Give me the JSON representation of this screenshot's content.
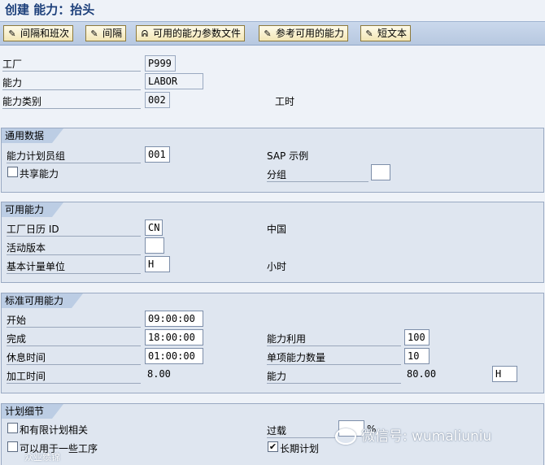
{
  "window": {
    "title": "创建 能力：抬头"
  },
  "toolbar": {
    "buttons": [
      {
        "label": "间隔和班次",
        "icon": "pencil-icon"
      },
      {
        "label": "间隔",
        "icon": "pencil-icon"
      },
      {
        "label": "可用的能力参数文件",
        "icon": "glasses-icon"
      },
      {
        "label": "参考可用的能力",
        "icon": "pencil-icon"
      },
      {
        "label": "短文本",
        "icon": "pencil-icon"
      }
    ]
  },
  "header": {
    "plant_label": "工厂",
    "plant_value": "P999",
    "capacity_label": "能力",
    "capacity_value": "LABOR",
    "capacity_category_label": "能力类别",
    "capacity_category_value": "002",
    "capacity_category_text": "工时"
  },
  "general_data": {
    "title": "通用数据",
    "planner_group_label": "能力计划员组",
    "planner_group_value": "001",
    "planner_group_text": "SAP 示例",
    "pooled_capacity_label": "共享能力",
    "pooled_capacity_checked": false,
    "grouping_label": "分组",
    "grouping_value": ""
  },
  "available_capacity": {
    "title": "可用能力",
    "factory_calendar_label": "工厂日历 ID",
    "factory_calendar_value": "CN",
    "factory_calendar_text": "中国",
    "active_version_label": "活动版本",
    "active_version_value": "",
    "base_unit_label": "基本计量单位",
    "base_unit_value": "H",
    "base_unit_text": "小时"
  },
  "standard_capacity": {
    "title": "标准可用能力",
    "start_label": "开始",
    "start_value": "09:00:00",
    "finish_label": "完成",
    "finish_value": "18:00:00",
    "break_label": "休息时间",
    "break_value": "01:00:00",
    "operating_time_label": "加工时间",
    "operating_time_value": "8.00",
    "utilization_label": "能力利用",
    "utilization_value": "100",
    "num_capacities_label": "单项能力数量",
    "num_capacities_value": "10",
    "capacity_label": "能力",
    "capacity_value": "80.00",
    "capacity_unit": "H"
  },
  "planning_details": {
    "title": "计划细节",
    "finite_scheduling_label": "和有限计划相关",
    "finite_scheduling_checked": false,
    "multiple_ops_label": "可以用于一些工序",
    "multiple_ops_checked": false,
    "overload_label": "过载",
    "overload_value": "",
    "overload_unit": "%",
    "long_term_label": "长期计划",
    "long_term_checked": true,
    "long_term_check_mark": "✔"
  },
  "watermark": {
    "text": "微信号: wumaliuniu",
    "small_text": "众业绩锦"
  }
}
